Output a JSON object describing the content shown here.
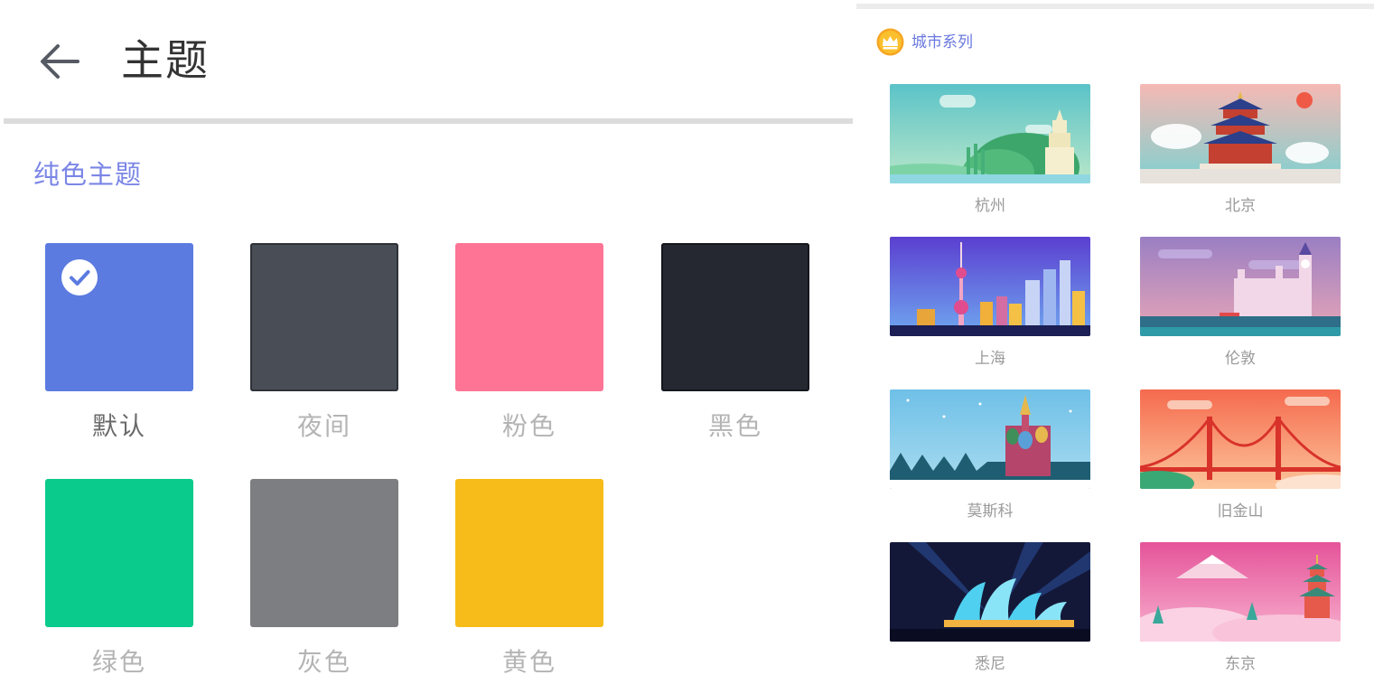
{
  "header": {
    "title": "主题",
    "back_icon": "arrow-left-icon"
  },
  "solid_section": {
    "title": "纯色主题",
    "selected": "默认",
    "themes": [
      {
        "label": "默认",
        "color": "#5b7be0",
        "selected": true
      },
      {
        "label": "夜间",
        "color": "#494e56",
        "selected": false
      },
      {
        "label": "粉色",
        "color": "#fd7495",
        "selected": false
      },
      {
        "label": "黑色",
        "color": "#252830",
        "selected": false
      },
      {
        "label": "绿色",
        "color": "#0acb8b",
        "selected": false
      },
      {
        "label": "灰色",
        "color": "#7d7e81",
        "selected": false
      },
      {
        "label": "黄色",
        "color": "#f7bc19",
        "selected": false
      }
    ]
  },
  "city_section": {
    "title": "城市系列",
    "icon": "crown-icon",
    "cities": [
      {
        "label": "杭州"
      },
      {
        "label": "北京"
      },
      {
        "label": "上海"
      },
      {
        "label": "伦敦"
      },
      {
        "label": "莫斯科"
      },
      {
        "label": "旧金山"
      },
      {
        "label": "悉尼"
      },
      {
        "label": "东京"
      }
    ]
  },
  "colors": {
    "accent": "#7b86e6",
    "check": "#5b7be0"
  }
}
